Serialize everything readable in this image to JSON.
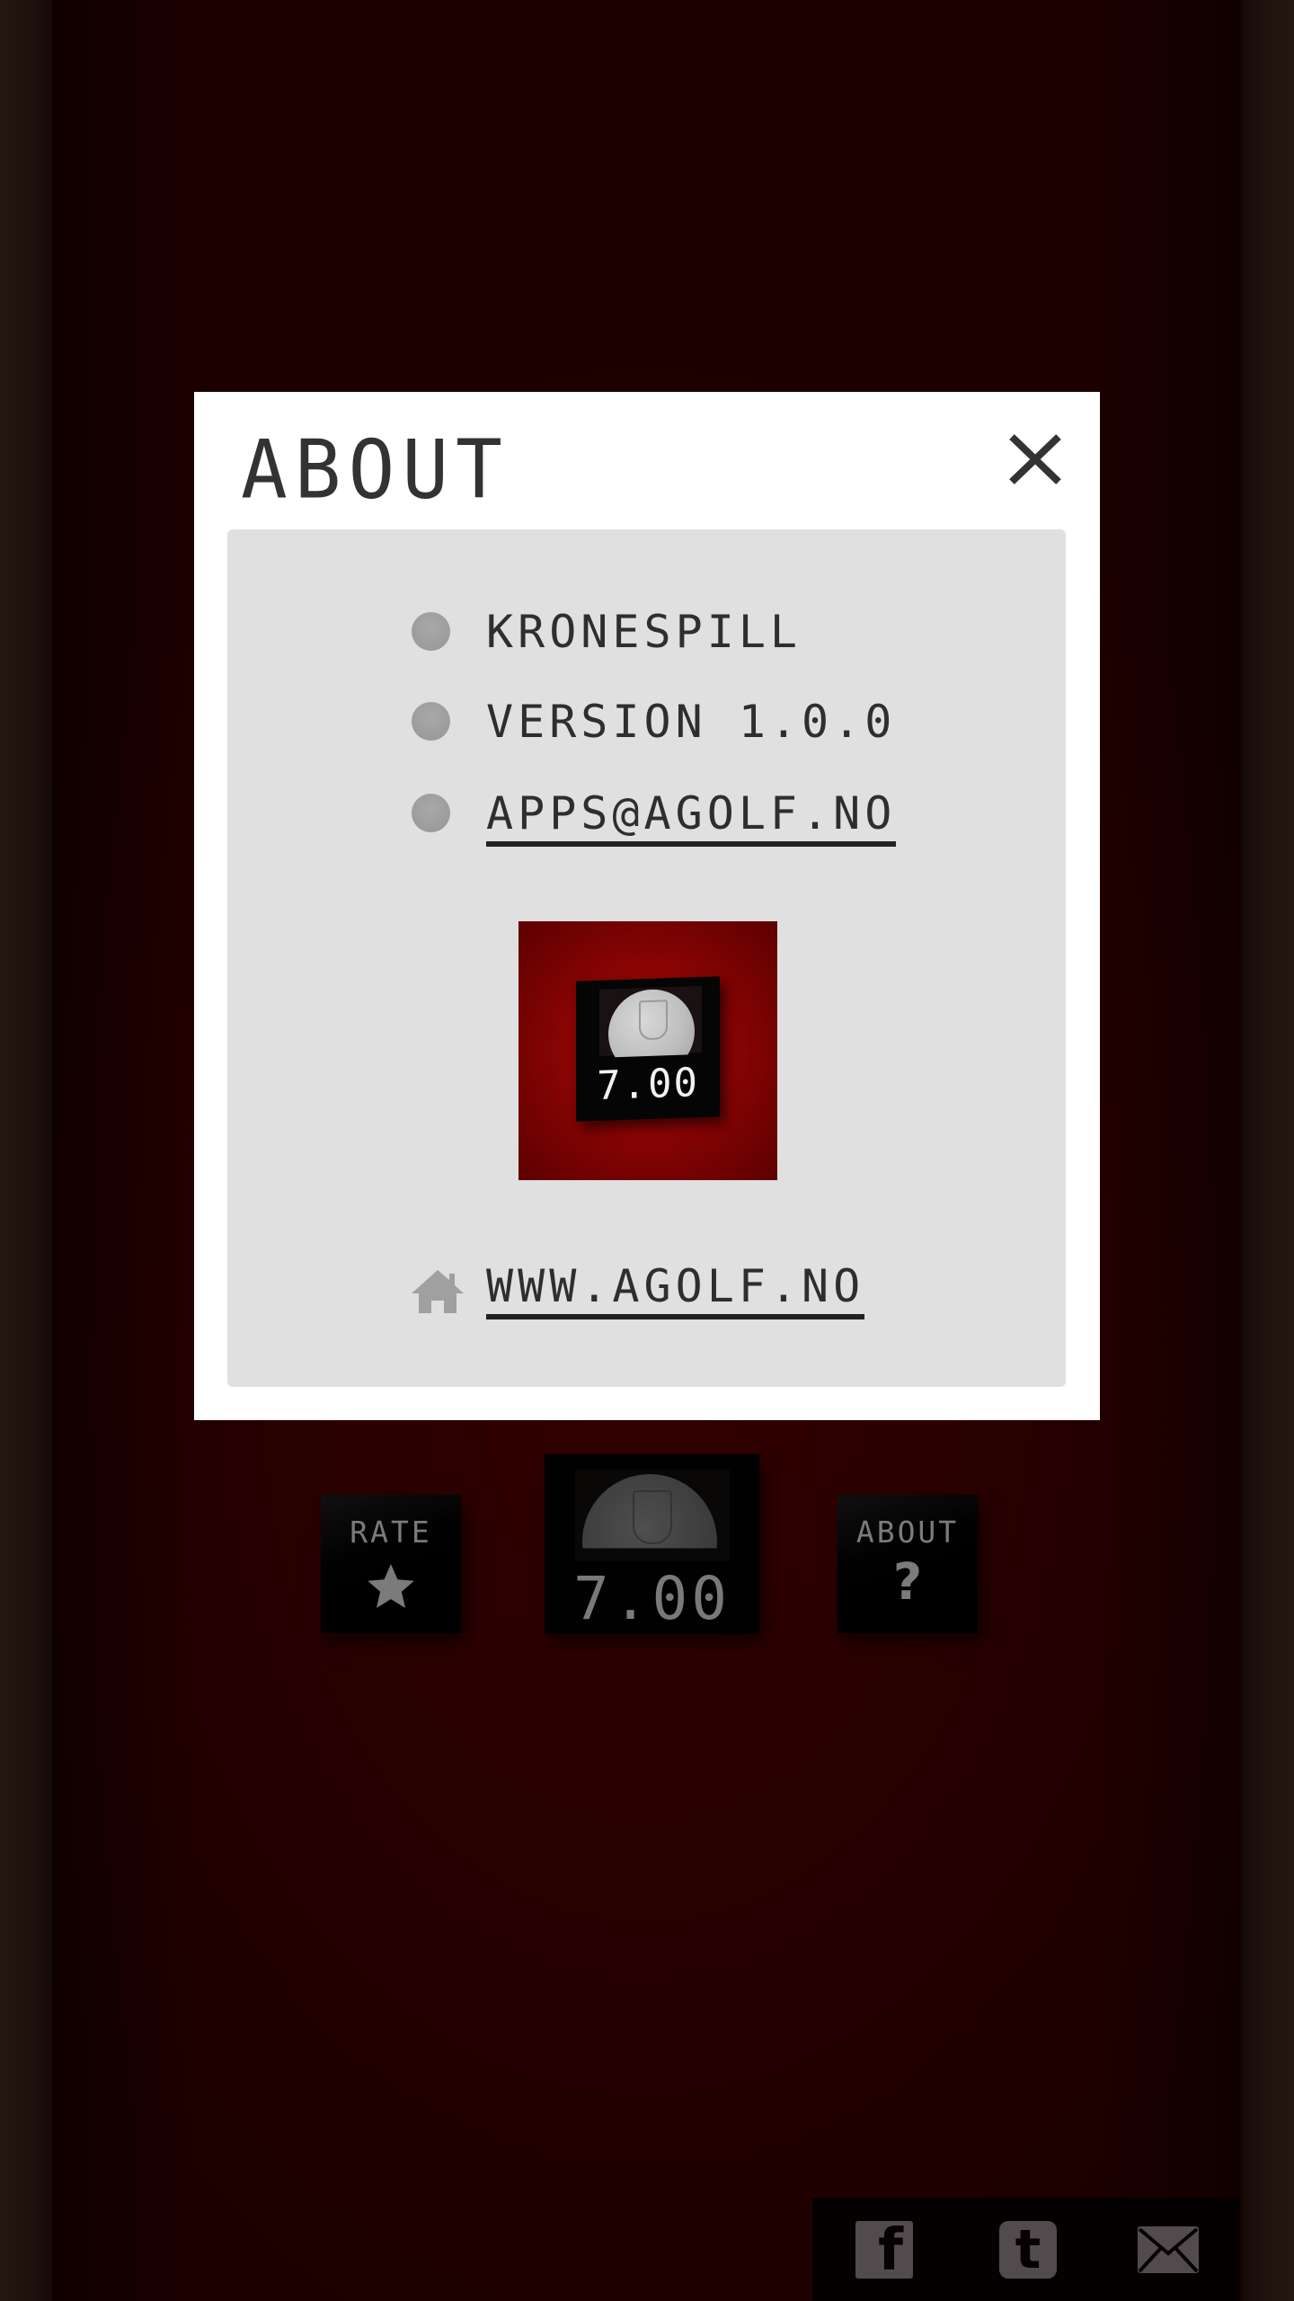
{
  "background_app": {
    "controls": {
      "rate_button": {
        "label": "RATE",
        "icon": "star-icon"
      },
      "about_button": {
        "label": "ABOUT",
        "icon": "question-icon",
        "icon_glyph": "?"
      },
      "coin_counter": {
        "value": "7.00"
      }
    },
    "social_bar": [
      {
        "name": "facebook",
        "icon": "facebook-icon",
        "glyph": "f"
      },
      {
        "name": "tumblr",
        "icon": "tumblr-icon",
        "glyph": "t"
      },
      {
        "name": "email",
        "icon": "mail-icon"
      }
    ]
  },
  "dialog": {
    "title": "ABOUT",
    "close_label": "X",
    "items": [
      {
        "text": "KRONESPILL",
        "link": false
      },
      {
        "text": "VERSION 1.0.0",
        "link": false
      },
      {
        "text": "APPS@AGOLF.NO",
        "link": true
      }
    ],
    "app_icon": {
      "counter_value": "7.00"
    },
    "website": {
      "text": "WWW.AGOLF.NO",
      "icon": "home-icon"
    }
  },
  "colors": {
    "background": "#330000",
    "dialog": "#ffffff",
    "panel": "#e0e0e0",
    "text": "#2e2e2e",
    "bullet": "#9c9c9c",
    "app_icon_red": "#8a0404"
  }
}
